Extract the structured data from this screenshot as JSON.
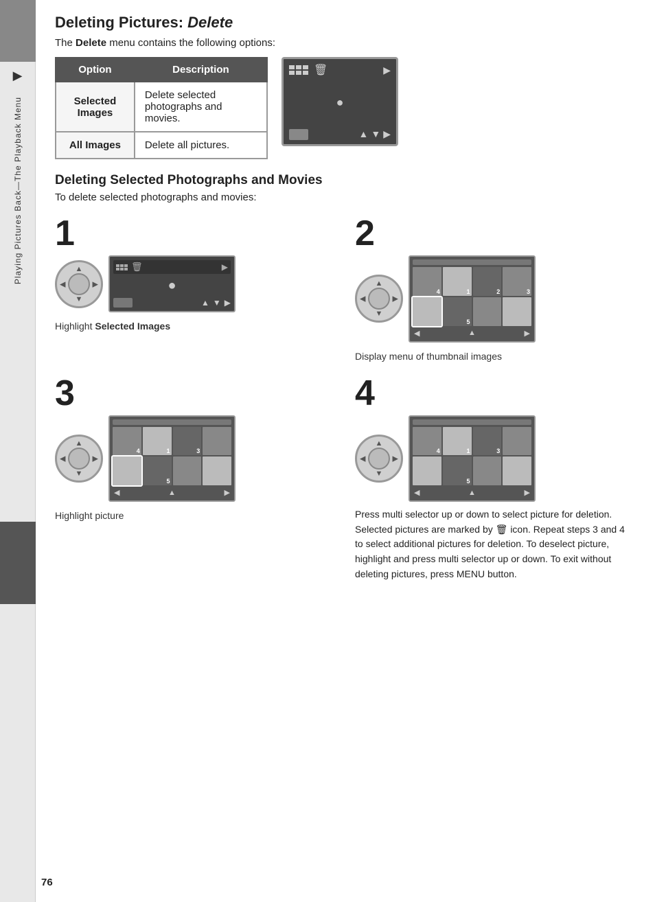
{
  "sidebar": {
    "text": "Playing Pictures Back—The Playback Menu"
  },
  "page": {
    "number": "76"
  },
  "title": {
    "text_plain": "Deleting Pictures: ",
    "text_italic": "Delete"
  },
  "intro": {
    "text": "The Delete menu contains the following options:"
  },
  "table": {
    "col1_header": "Option",
    "col2_header": "Description",
    "rows": [
      {
        "option": "Selected Images",
        "description": "Delete selected photographs and movies."
      },
      {
        "option": "All Images",
        "description": "Delete all pictures."
      }
    ]
  },
  "section1": {
    "heading": "Deleting Selected Photographs and Movies",
    "subtext": "To delete selected photographs and movies:"
  },
  "steps": [
    {
      "number": "1",
      "caption_plain": "Highlight ",
      "caption_bold": "Selected Images"
    },
    {
      "number": "2",
      "caption": "Display menu of thumbnail images"
    },
    {
      "number": "3",
      "caption": "Highlight picture"
    },
    {
      "number": "4",
      "caption": "Press multi selector up or down to select picture for deletion.  Selected pictures are marked by 🗑 icon.  Repeat steps 3 and 4 to select additional pictures for deletion.  To deselect picture, highlight and press multi selector up or down.  To exit without deleting pictures, press MENU button."
    }
  ]
}
